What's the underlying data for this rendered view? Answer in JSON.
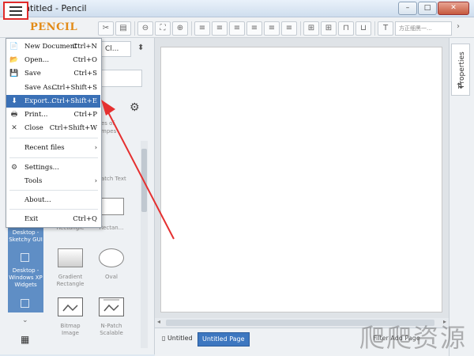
{
  "window": {
    "title": "Untitled - Pencil",
    "controls": [
      "–",
      "□",
      "✕"
    ]
  },
  "toolbar": {
    "logo": "PENCIL",
    "font_placeholder": "方正细黑一...",
    "more": "›",
    "buttons": [
      {
        "name": "clipboard-tab-icon",
        "glyph": "▣"
      },
      {
        "name": "cut-icon",
        "glyph": "✂"
      },
      {
        "name": "paste-icon",
        "glyph": "📋"
      },
      {
        "name": "zoom-out-icon",
        "glyph": "🔍"
      },
      {
        "name": "fit-icon",
        "glyph": "⛶"
      },
      {
        "name": "zoom-in-icon",
        "glyph": "🔍"
      },
      {
        "name": "align-left-icon",
        "glyph": "☰"
      },
      {
        "name": "align-center-icon",
        "glyph": "☰"
      },
      {
        "name": "align-right-icon",
        "glyph": "☰"
      },
      {
        "name": "distribute-icon",
        "glyph": "☰"
      },
      {
        "name": "spacing-icon",
        "glyph": "☰"
      },
      {
        "name": "same-width-icon",
        "glyph": "⊓"
      },
      {
        "name": "same-height-icon",
        "glyph": "⊔"
      },
      {
        "name": "text-style-icon",
        "glyph": "T"
      }
    ]
  },
  "left_panel": {
    "tab_label": "Cl...",
    "partial_texts": [
      "n",
      "es of",
      "mpes",
      "Hands",
      "Sty label",
      "cure"
    ],
    "shapes": [
      {
        "label": "Rectangle",
        "top_label": ""
      },
      {
        "label": "Rectan...",
        "top_label": ""
      },
      {
        "label": "Gradient Rectangle"
      },
      {
        "label": "Oval"
      },
      {
        "label": "Bitmap Image"
      },
      {
        "label": "N-Patch Scalable"
      }
    ],
    "patch_text": "atch Text",
    "categories": [
      {
        "label": "Desktop - Sketchy GUI"
      },
      {
        "label": "Desktop - Windows XP Widgets"
      }
    ]
  },
  "menu": {
    "items": [
      {
        "icon": "📄",
        "label": "New Document",
        "shortcut": "Ctrl+N"
      },
      {
        "icon": "📂",
        "label": "Open...",
        "shortcut": "Ctrl+O"
      },
      {
        "icon": "💾",
        "label": "Save",
        "shortcut": "Ctrl+S"
      },
      {
        "icon": "",
        "label": "Save As...",
        "shortcut": "Ctrl+Shift+S"
      },
      {
        "icon": "⬇",
        "label": "Export...",
        "shortcut": "Ctrl+Shift+E"
      },
      {
        "icon": "🖶",
        "label": "Print...",
        "shortcut": "Ctrl+P"
      },
      {
        "icon": "✕",
        "label": "Close",
        "shortcut": "Ctrl+Shift+W"
      },
      {
        "icon": "",
        "label": "Recent files",
        "shortcut": "›"
      },
      {
        "icon": "⚙",
        "label": "Settings...",
        "shortcut": ""
      },
      {
        "icon": "",
        "label": "Tools",
        "shortcut": "›"
      },
      {
        "icon": "",
        "label": "About...",
        "shortcut": ""
      },
      {
        "icon": "",
        "label": "Exit",
        "shortcut": "Ctrl+Q"
      }
    ]
  },
  "properties": {
    "label": "Properties",
    "icon": "⇅"
  },
  "status": {
    "page_tab_inactive": "Untitled",
    "page_tab_active": "Untitled Page",
    "right_text": "Filter  Add Page"
  },
  "watermark": "爬爬资源"
}
